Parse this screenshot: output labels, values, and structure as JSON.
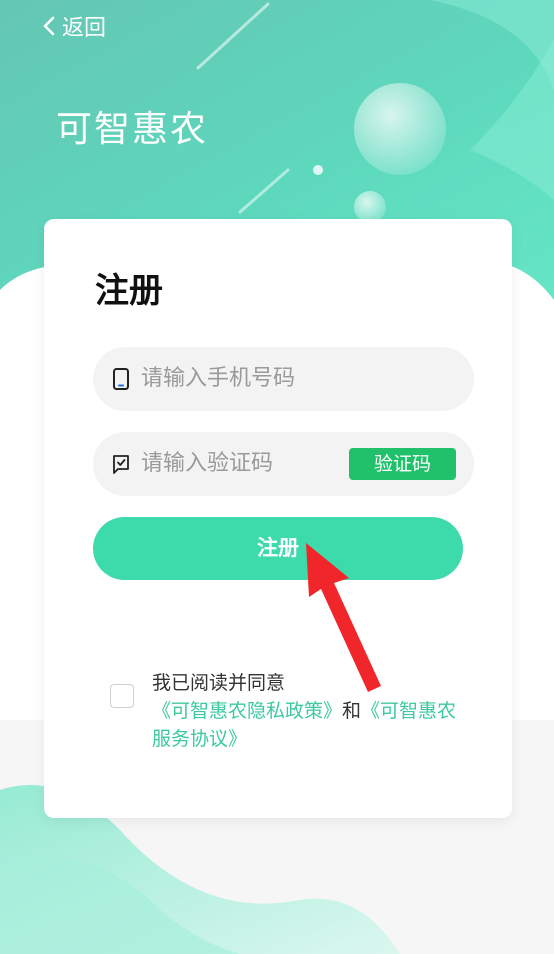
{
  "nav": {
    "back_label": "返回"
  },
  "header": {
    "app_title": "可智惠农"
  },
  "form": {
    "title": "注册",
    "phone_placeholder": "请输入手机号码",
    "code_placeholder": "请输入验证码",
    "code_button_label": "验证码",
    "submit_label": "注册"
  },
  "agreement": {
    "prefix": "我已阅读并同意",
    "privacy_link": "《可智惠农隐私政策》",
    "conjunction": "和",
    "service_link": "《可智惠农服务协议》",
    "checked": false
  },
  "icons": {
    "back": "chevron-left-icon",
    "phone": "phone-icon",
    "code": "message-check-icon"
  },
  "colors": {
    "header_bg": "#5fd8bd",
    "accent": "#3ddbab",
    "code_button": "#21c16b",
    "link": "#3cc9a0",
    "annotation_arrow": "#f0262a"
  }
}
